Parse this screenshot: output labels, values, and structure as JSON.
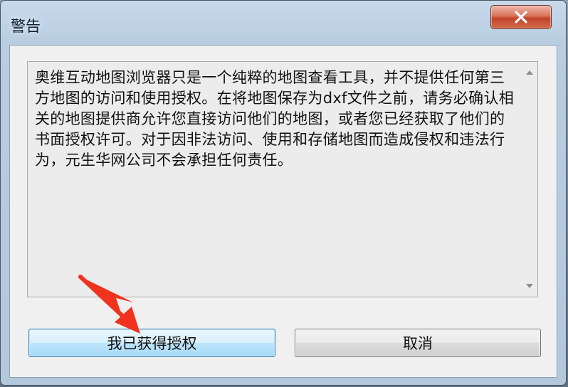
{
  "window": {
    "title": "警告",
    "close_icon": "close-icon"
  },
  "message": {
    "text": "奥维互动地图浏览器只是一个纯粹的地图查看工具，并不提供任何第三方地图的访问和使用授权。在将地图保存为dxf文件之前，请务必确认相关的地图提供商允许您直接访问他们的地图，或者您已经获取了他们的书面授权许可。对于因非法访问、使用和存储地图而造成侵权和违法行为，元生华网公司不会承担任何责任。"
  },
  "buttons": {
    "confirm_label": "我已获得授权",
    "cancel_label": "取消"
  },
  "colors": {
    "annotation_arrow": "#f0321e",
    "close_button": "#c4432a"
  }
}
